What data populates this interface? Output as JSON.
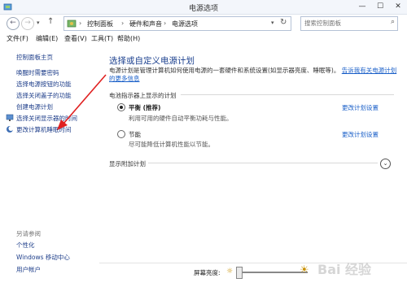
{
  "window": {
    "title": "电源选项",
    "controls": [
      "—",
      "☐",
      "✕"
    ]
  },
  "addressbar": {
    "crumbs": [
      "控制面板",
      "硬件和声音",
      "电源选项"
    ],
    "search_placeholder": "搜索控制面板"
  },
  "menu": {
    "items": [
      "文件(F)",
      "编辑(E)",
      "查看(V)",
      "工具(T)",
      "帮助(H)"
    ]
  },
  "sidebar": {
    "home": "控制面板主页",
    "links": [
      "唤醒时需要密码",
      "选择电源按钮的功能",
      "选择关闭盖子的功能",
      "创建电源计划",
      "选择关闭显示器的时间",
      "更改计算机睡眠时间"
    ],
    "see_also": "另请参阅",
    "see_links": [
      "个性化",
      "Windows 移动中心",
      "用户帐户"
    ]
  },
  "main": {
    "heading": "选择或自定义电源计划",
    "description": "电源计划是管理计算机如何使用电源的一套硬件和系统设置(如显示器亮度、睡眠等)。",
    "description_link": "告诉我有关电源计划的更多信息",
    "section_label": "电池指示器上显示的计划",
    "plans": [
      {
        "name": "平衡 (推荐)",
        "desc": "利用可用的硬件自动平衡功耗与性能。",
        "link": "更改计划设置",
        "selected": true
      },
      {
        "name": "节能",
        "desc": "尽可能降低计算机性能以节能。",
        "link": "更改计划设置",
        "selected": false
      }
    ],
    "additional": "显示附加计划"
  },
  "bottom": {
    "brightness_label": "屏幕亮度:",
    "brightness_level": 0
  },
  "watermark": "Bai 经验"
}
